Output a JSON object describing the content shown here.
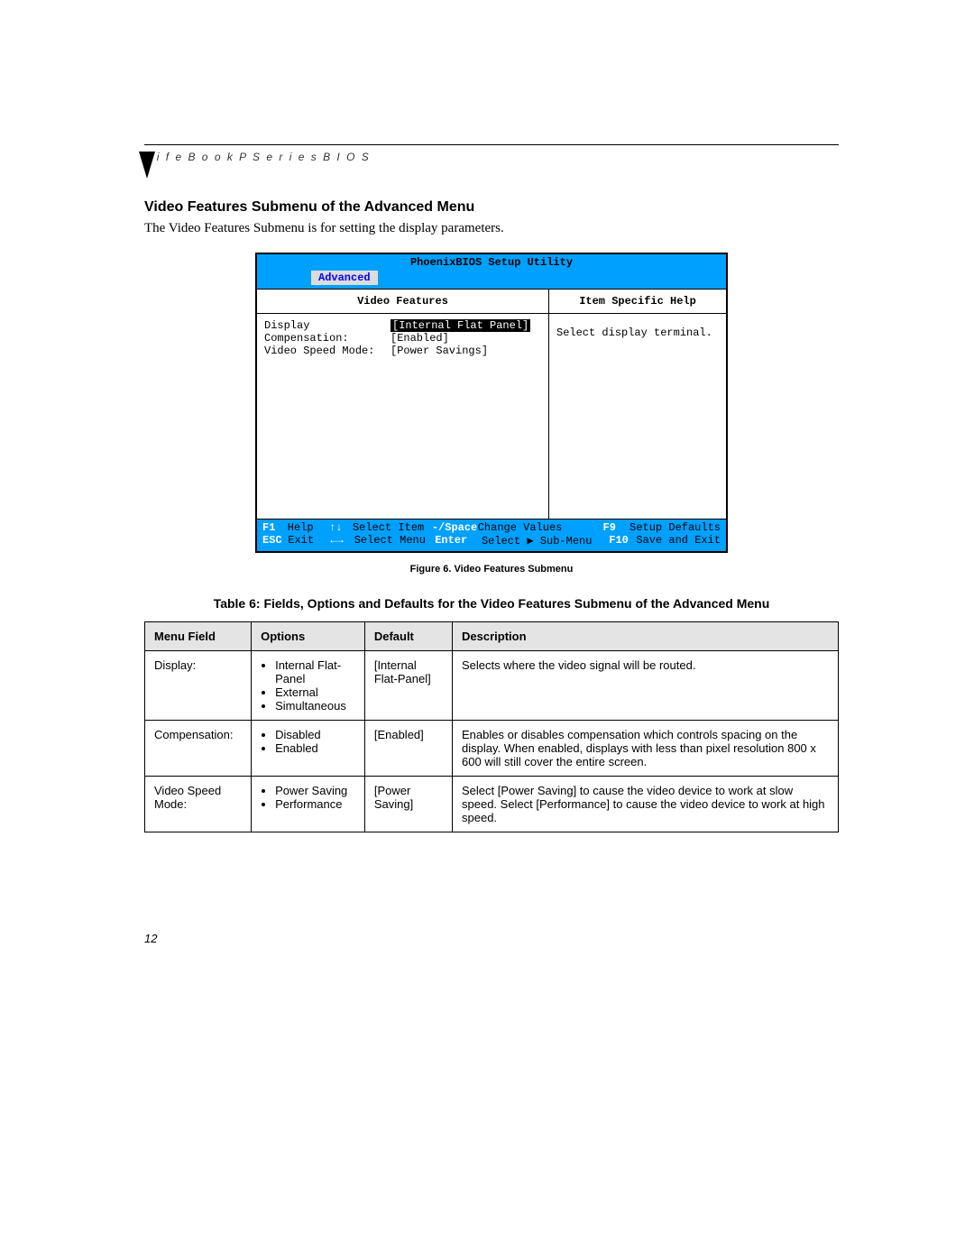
{
  "header": "L i f e B o o k   P   S e r i e s   B I O S",
  "section_title": "Video Features Submenu of the Advanced Menu",
  "section_desc": "The Video Features Submenu is for setting the display parameters.",
  "bios": {
    "utility_title": "PhoenixBIOS Setup Utility",
    "tab": "Advanced",
    "left_title": "Video Features",
    "right_title": "Item Specific Help",
    "rows": [
      {
        "label": "Display",
        "value": "[Internal Flat Panel]",
        "selected": true
      },
      {
        "label": "Compensation:",
        "value": "[Enabled]",
        "selected": false
      },
      {
        "label": "Video Speed Mode:",
        "value": "[Power Savings]",
        "selected": false
      }
    ],
    "help_text": "Select display terminal.",
    "footer": {
      "r1": {
        "k1": "F1",
        "v1": "Help",
        "k2": "↑↓",
        "v2": "Select Item",
        "k3": "-/Space",
        "v3": "Change Values",
        "k4": "F9",
        "v4": "Setup Defaults"
      },
      "r2": {
        "k1": "ESC",
        "v1": "Exit",
        "k2": "←→",
        "v2": "Select Menu",
        "k3": "Enter",
        "v3": "Select ▶ Sub-Menu",
        "k4": "F10",
        "v4": "Save and Exit"
      }
    }
  },
  "fig_caption": "Figure 6.  Video Features Submenu",
  "table_title": "Table 6: Fields, Options and Defaults for the Video Features Submenu of the Advanced Menu",
  "table": {
    "headers": [
      "Menu Field",
      "Options",
      "Default",
      "Description"
    ],
    "rows": [
      {
        "field": "Display:",
        "options": [
          "Internal Flat-Panel",
          "External",
          "Simultaneous"
        ],
        "default": "[Internal Flat-Panel]",
        "desc": "Selects where the video signal will be routed."
      },
      {
        "field": "Compensation:",
        "options": [
          "Disabled",
          "Enabled"
        ],
        "default": "[Enabled]",
        "desc": "Enables or disables compensation which controls spacing on the display. When enabled, displays with less than pixel resolution 800 x 600 will still cover the entire screen."
      },
      {
        "field": "Video Speed Mode:",
        "options": [
          "Power Saving",
          "Performance"
        ],
        "default": "[Power Saving]",
        "desc": "Select [Power Saving] to cause the video device to work at slow speed. Select [Performance] to cause the video device to work at high speed."
      }
    ]
  },
  "page_number": "12"
}
